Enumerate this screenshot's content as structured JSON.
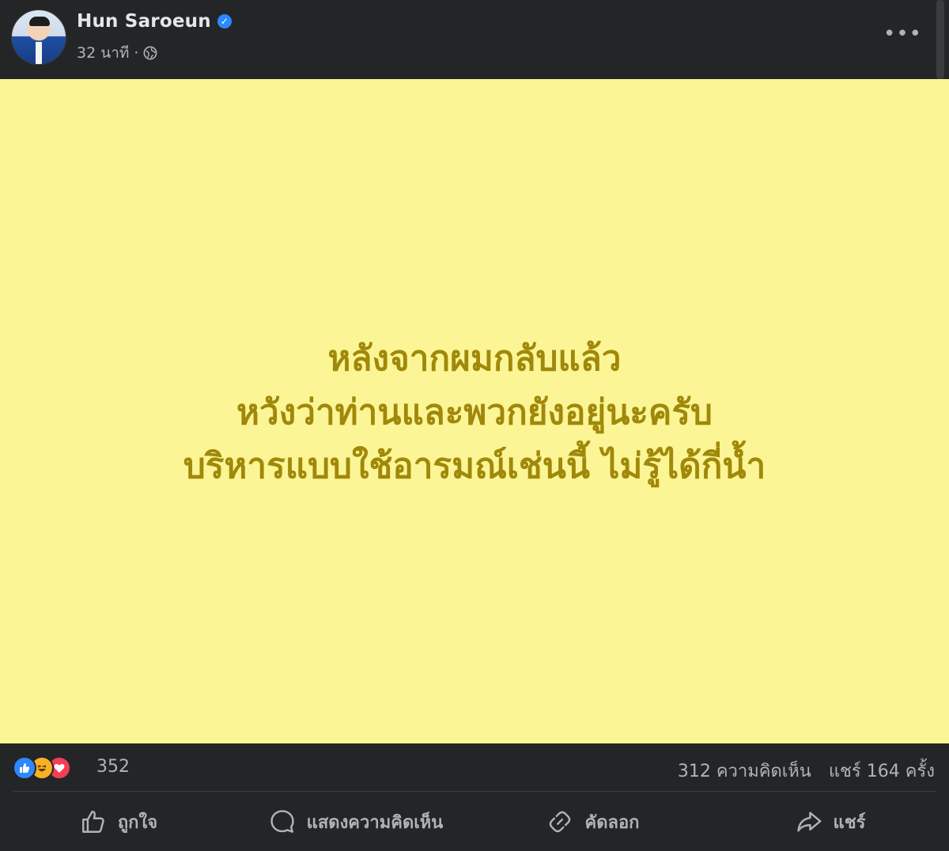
{
  "post": {
    "author": "Hun Saroeun",
    "time": "32 นาที",
    "separator": "·",
    "text_lines": [
      "หลังจากผมกลับแล้ว",
      "หวังว่าท่านและพวกยังอยู่นะครับ",
      "บริหารแบบใช้อารมณ์เช่นนี้ ไม่รู้ได้กี่น้ำ"
    ],
    "background_color": "#fbf595",
    "text_color": "#a0880a"
  },
  "stats": {
    "reactions_count": "352",
    "comments": "312 ความคิดเห็น",
    "shares": "แชร์ 164 ครั้ง"
  },
  "actions": {
    "like": "ถูกใจ",
    "comment": "แสดงความคิดเห็น",
    "copy": "คัดลอก",
    "share": "แชร์"
  },
  "icons": {
    "verified": "verified-badge-icon",
    "privacy": "globe-icon",
    "more": "more-options-icon",
    "reactions": [
      "like-icon",
      "haha-icon",
      "love-icon"
    ]
  },
  "colors": {
    "verified": "#2d88ff",
    "like": "#2d88ff",
    "haha": "#f7b125",
    "love": "#f33e58"
  }
}
